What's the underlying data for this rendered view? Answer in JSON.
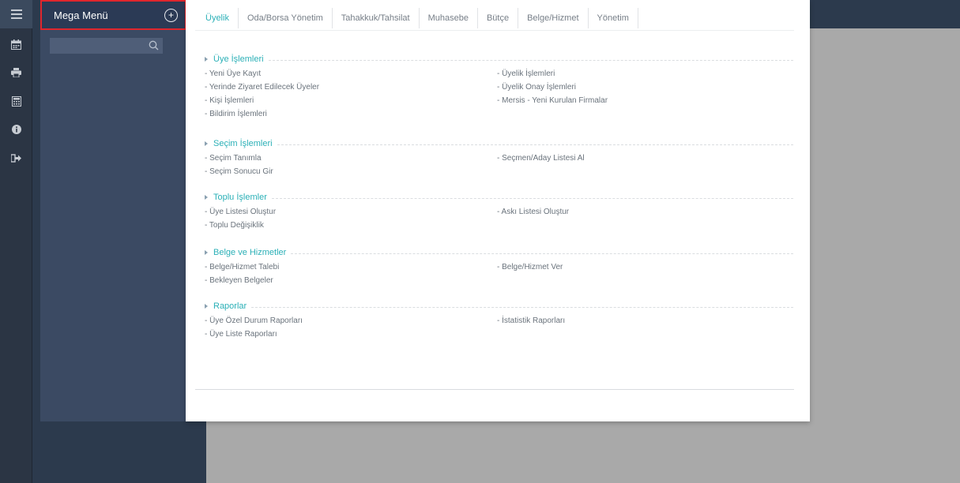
{
  "mega_menu": {
    "title": "Mega Menü",
    "add_symbol": "+",
    "search_placeholder": ""
  },
  "icons": [
    "bars-icon",
    "calendar-icon",
    "print-icon",
    "calculator-icon",
    "info-icon",
    "sign-out-icon"
  ],
  "tabs": [
    {
      "label": "Üyelik",
      "active": true
    },
    {
      "label": "Oda/Borsa Yönetim"
    },
    {
      "label": "Tahakkuk/Tahsilat"
    },
    {
      "label": "Muhasebe"
    },
    {
      "label": "Bütçe"
    },
    {
      "label": "Belge/Hizmet"
    },
    {
      "label": "Yönetim"
    }
  ],
  "sections": [
    {
      "title": "Üye İşlemleri",
      "left": [
        "- Yeni Üye Kayıt",
        "- Yerinde Ziyaret Edilecek Üyeler",
        "- Kişi İşlemleri",
        "- Bildirim İşlemleri"
      ],
      "right": [
        "- Üyelik İşlemleri",
        "- Üyelik Onay İşlemleri",
        "- Mersis - Yeni Kurulan Firmalar"
      ]
    },
    {
      "title": "Seçim İşlemleri",
      "left": [
        "- Seçim Tanımla",
        "- Seçim Sonucu Gir"
      ],
      "right": [
        "- Seçmen/Aday Listesi Al"
      ]
    },
    {
      "title": "Toplu İşlemler",
      "left": [
        "- Üye Listesi Oluştur",
        "- Toplu Değişiklik"
      ],
      "right": [
        "- Askı Listesi Oluştur"
      ]
    },
    {
      "title": "Belge ve Hizmetler",
      "left": [
        "- Belge/Hizmet Talebi",
        "- Bekleyen Belgeler"
      ],
      "right": [
        "- Belge/Hizmet Ver"
      ]
    },
    {
      "title": "Raporlar",
      "left": [
        "- Üye Özel Durum Raporları",
        "- Üye Liste Raporları"
      ],
      "right": [
        "- İstatistik Raporları"
      ]
    }
  ],
  "colors": {
    "accent": "#2bb0b7",
    "highlight_border": "#e0262d",
    "sidebar": "#3b4a63",
    "rail": "#2b3544"
  }
}
